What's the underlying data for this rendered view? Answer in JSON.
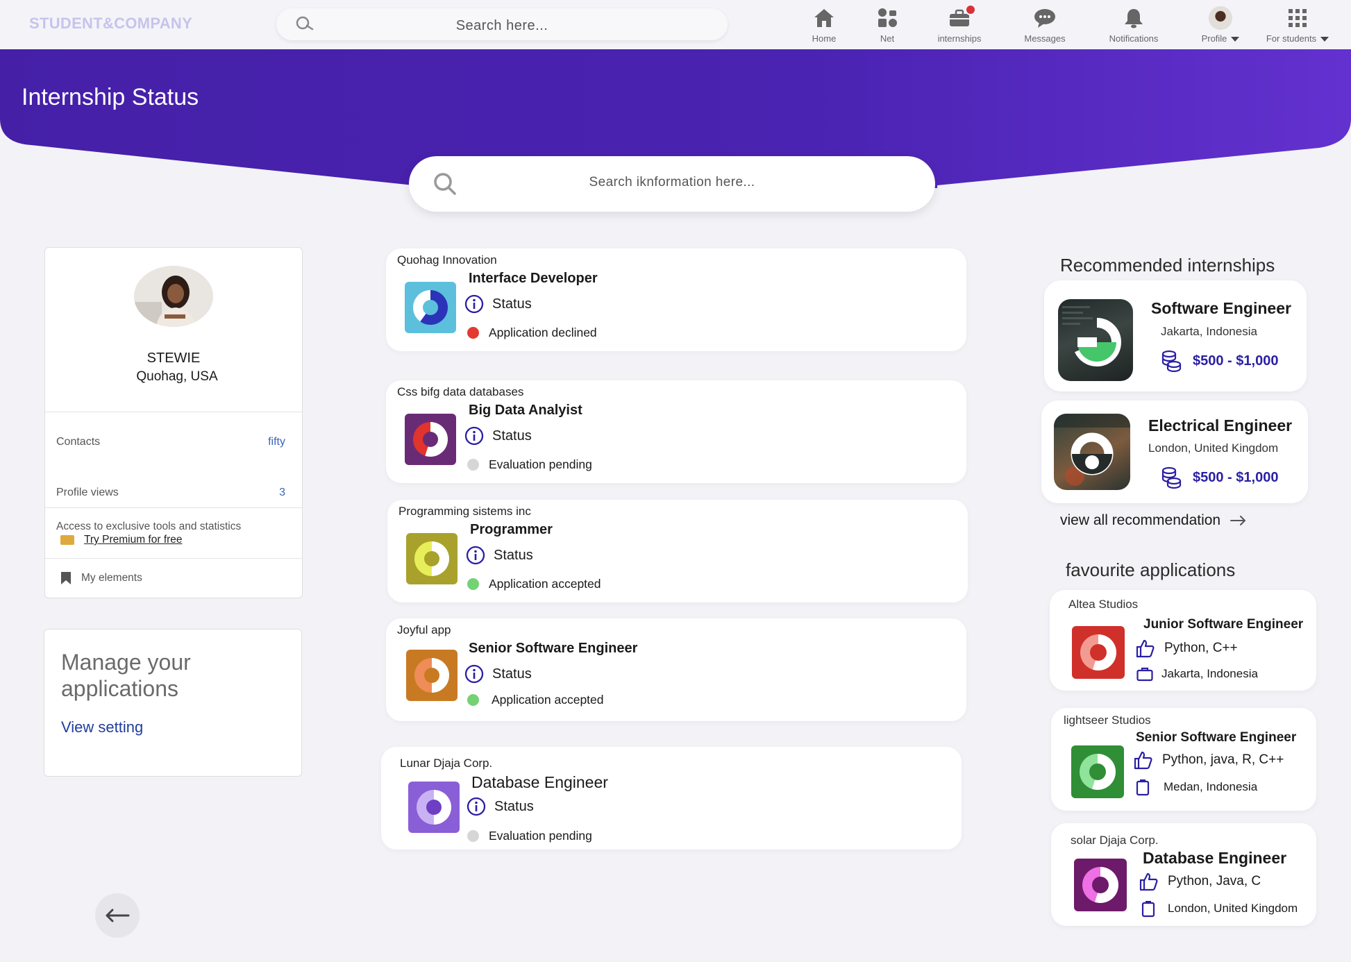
{
  "app": {
    "logo": "STUDENT&COMPANY",
    "search_placeholder": "Search  here..."
  },
  "nav": {
    "home": "Home",
    "net": "Net",
    "internships": "internships",
    "messages": "Messages",
    "notifications": "Notifications",
    "profile": "Profile",
    "for_students": "For students"
  },
  "header": {
    "title": "Internship Status",
    "search_placeholder": "Search iknformation  here..."
  },
  "profile": {
    "name": "STEWIE",
    "location": "Quohag, USA",
    "contacts_label": "Contacts",
    "contacts_value": "fifty",
    "views_label": "Profile views",
    "views_value": "3",
    "premium_text": "Access to exclusive tools and statistics",
    "premium_link": "Try Premium for free",
    "my_elements": "My elements"
  },
  "manage": {
    "title": "Manage your applications",
    "link": "View setting"
  },
  "status_label": "Status",
  "applications": [
    {
      "company": "Quohag Innovation",
      "title": "Interface Developer",
      "state": "Application declined",
      "state_color": "#e23a2e"
    },
    {
      "company": "Css bifg data databases",
      "title": "Big Data Analyist",
      "state": "Evaluation pending",
      "state_color": "#d6d6d6"
    },
    {
      "company": "Programming sistems inc",
      "title": "Programmer",
      "state": "Application accepted",
      "state_color": "#74d274"
    },
    {
      "company": "Joyful app",
      "title": "Senior Software Engineer",
      "state": "Application accepted",
      "state_color": "#74d274"
    },
    {
      "company": "Lunar Djaja Corp.",
      "title": "Database Engineer",
      "state": "Evaluation pending",
      "state_color": "#d6d6d6"
    }
  ],
  "recommended": {
    "title": "Recommended internships",
    "items": [
      {
        "title": "Software Engineer",
        "location": "Jakarta, Indonesia",
        "salary": "$500 - $1,000"
      },
      {
        "title": "Electrical Engineer",
        "location": "London, United Kingdom",
        "salary": "$500 - $1,000"
      }
    ],
    "view_all": "view all recommendation"
  },
  "favourites": {
    "title": "favourite applications",
    "items": [
      {
        "company": "Altea Studios",
        "title": "Junior Software Engineer",
        "skills": "Python, C++",
        "location": "Jakarta, Indonesia"
      },
      {
        "company": "lightseer Studios",
        "title": "Senior Software Engineer",
        "skills": "Python, java, R, C++",
        "location": "Medan, Indonesia"
      },
      {
        "company": "solar Djaja Corp.",
        "title": "Database Engineer",
        "skills": "Python, Java, C",
        "location": "London, United Kingdom"
      }
    ]
  },
  "colors": {
    "brand_purple": "#4a22b0",
    "accent_blue": "#2a1fa4"
  }
}
